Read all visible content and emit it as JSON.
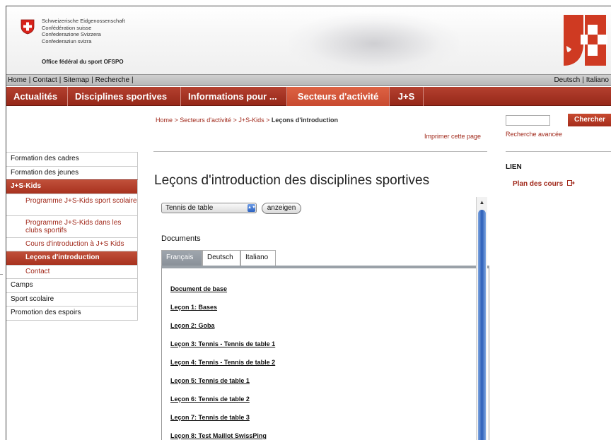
{
  "header": {
    "confederation_lines": [
      "Schweizerische Eidgenossenschaft",
      "Confédération suisse",
      "Confederazione Svizzera",
      "Confederaziun svizra"
    ],
    "office": "Office fédéral du sport OFSPO",
    "brand_color": "#b4402f"
  },
  "metabar": {
    "links": [
      "Home",
      "Contact",
      "Sitemap",
      "Recherche"
    ],
    "languages": [
      "Deutsch",
      "Italiano"
    ]
  },
  "mainnav": {
    "tabs": [
      {
        "label": "Actualités"
      },
      {
        "label": "Disciplines sportives"
      },
      {
        "label": "Informations pour ..."
      },
      {
        "label": "Secteurs d'activité"
      },
      {
        "label": "J+S"
      }
    ],
    "active": "Secteurs d'activité"
  },
  "breadcrumb": {
    "parts": [
      "Home",
      "Secteurs d'activité",
      "J+S-Kids"
    ],
    "current": "Leçons d'introduction",
    "separator": " > "
  },
  "print_label": "Imprimer cette page",
  "search": {
    "button": "Chercher",
    "advanced": "Recherche avancée",
    "value": ""
  },
  "lien": {
    "heading": "LIEN",
    "link": "Plan des cours"
  },
  "sidebar": {
    "items": [
      {
        "label": "Formation des cadres"
      },
      {
        "label": "Formation des jeunes"
      },
      {
        "label": "J+S-Kids"
      },
      {
        "label": "Programme J+S-Kids sport scolaire"
      },
      {
        "label": "Programme J+S-Kids dans les clubs sportifs"
      },
      {
        "label": "Cours d'introduction à J+S Kids"
      },
      {
        "label": "Leçons d'introduction"
      },
      {
        "label": "Contact"
      },
      {
        "label": "Camps"
      },
      {
        "label": "Sport scolaire"
      },
      {
        "label": "Promotion des espoirs"
      }
    ]
  },
  "main": {
    "title": "Leçons d'introduction des disciplines sportives",
    "select_value": "Tennis de table",
    "go_button": "anzeigen",
    "documents_label": "Documents",
    "tabs": [
      "Français",
      "Deutsch",
      "Italiano"
    ],
    "active_tab": "Français",
    "documents": [
      "Document de base",
      "Leçon 1: Bases",
      "Leçon 2: Goba",
      "Leçon 3: Tennis - Tennis de table 1",
      "Leçon 4: Tennis - Tennis de table 2",
      "Leçon 5: Tennis de table 1",
      "Leçon 6: Tennis de table 2",
      "Leçon 7: Tennis de table 3",
      "Leçon 8: Test Maillot SwissPing"
    ]
  }
}
